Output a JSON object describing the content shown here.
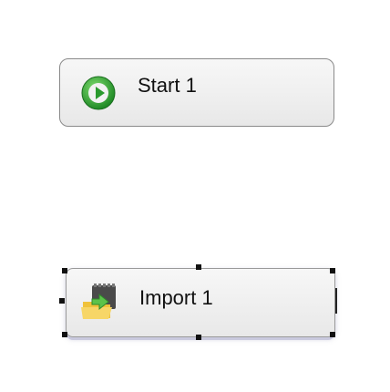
{
  "canvas": {
    "nodes": [
      {
        "id": "start-1",
        "label": "Start 1",
        "icon": "play-icon",
        "selected": false,
        "icon_color": "#2e9e2e"
      },
      {
        "id": "import-1",
        "label": "Import 1",
        "icon": "import-folder-icon",
        "selected": true,
        "icon_color": "#f0c23b"
      }
    ]
  }
}
